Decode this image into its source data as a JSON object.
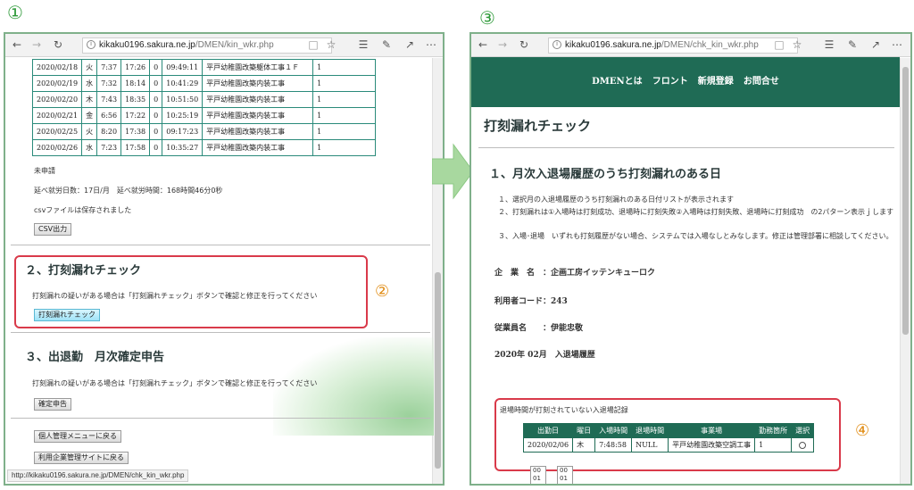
{
  "markers": {
    "m1": "①",
    "m2": "②",
    "m3": "③",
    "m4": "④"
  },
  "left": {
    "url_host": "kikaku0196.sakura.ne.jp",
    "url_path": "/DMEN/kin_wkr.php",
    "rows": [
      [
        "2020/02/18",
        "火",
        "7:37",
        "17:26",
        "0",
        "09:49:11",
        "平戸幼稚園改築躯体工事１Ｆ",
        "1"
      ],
      [
        "2020/02/19",
        "水",
        "7:32",
        "18:14",
        "0",
        "10:41:29",
        "平戸幼稚園改築内装工事",
        "1"
      ],
      [
        "2020/02/20",
        "木",
        "7:43",
        "18:35",
        "0",
        "10:51:50",
        "平戸幼稚園改築内装工事",
        "1"
      ],
      [
        "2020/02/21",
        "金",
        "6:56",
        "17:22",
        "0",
        "10:25:19",
        "平戸幼稚園改築内装工事",
        "1"
      ],
      [
        "2020/02/25",
        "火",
        "8:20",
        "17:38",
        "0",
        "09:17:23",
        "平戸幼稚園改築内装工事",
        "1"
      ],
      [
        "2020/02/26",
        "水",
        "7:23",
        "17:58",
        "0",
        "10:35:27",
        "平戸幼稚園改築内装工事",
        "1"
      ]
    ],
    "status": "未申請",
    "totals": "延べ就労日数：17日/月　延べ就労時間：168時間46分0秒",
    "csv_saved": "csvファイルは保存されました",
    "csv_button": "CSV出力",
    "sec2_title": "２、打刻漏れチェック",
    "sec2_text": "打刻漏れの疑いがある場合は「打刻漏れチェック」ボタンで確認と修正を行ってください",
    "sec2_button": "打刻漏れチェック",
    "sec3_title": "３、出退勤　月次確定申告",
    "sec3_text": "打刻漏れの疑いがある場合は「打刻漏れチェック」ボタンで確認と修正を行ってください",
    "sec3_button": "確定申告",
    "back_menu": "個人管理メニューに戻る",
    "back_site": "利用企業管理サイトに戻る",
    "status_url": "http://kikaku0196.sakura.ne.jp/DMEN/chk_kin_wkr.php"
  },
  "right": {
    "url_host": "kikaku0196.sakura.ne.jp",
    "url_path": "/DMEN/chk_kin_wkr.php",
    "nav": [
      "DMENとは",
      "フロント",
      "新規登録",
      "お問合せ"
    ],
    "page_title": "打刻漏れチェック",
    "sec1_title": "１、月次入退場履歴のうち打刻漏れのある日",
    "desc1": "１、選択月の入退場履歴のうち打刻漏れのある日付リストが表示されます",
    "desc2": "２、打刻漏れは①入場時は打刻成功、退場時に打刻失敗②入場時は打刻失敗、退場時に打刻成功　の2パターン表示ｊします",
    "desc3": "３、入場･退場　いずれも打刻履歴がない場合、システムでは入場なしとみなします。修正は管理部署に相談してください。",
    "company_label": "企　業　名　：企画工房イッテンキューロク",
    "user_code_label": "利用者コード：243",
    "employee_label": "従業員名　　：伊能忠敬",
    "month_label": "2020年 02月　入退場履歴",
    "missing_caption": "退場時間が打刻されていない入退場記録",
    "missing_headers": [
      "出勤日",
      "曜日",
      "入場時間",
      "退場時間",
      "事業場",
      "勤務箇所",
      "選択"
    ],
    "missing_row": [
      "2020/02/06",
      "木",
      "7:48:58",
      "NULL",
      "平戸幼稚園改築空調工事",
      "1"
    ],
    "select_a": [
      "00",
      "01"
    ],
    "select_b": [
      "00",
      "01"
    ]
  }
}
